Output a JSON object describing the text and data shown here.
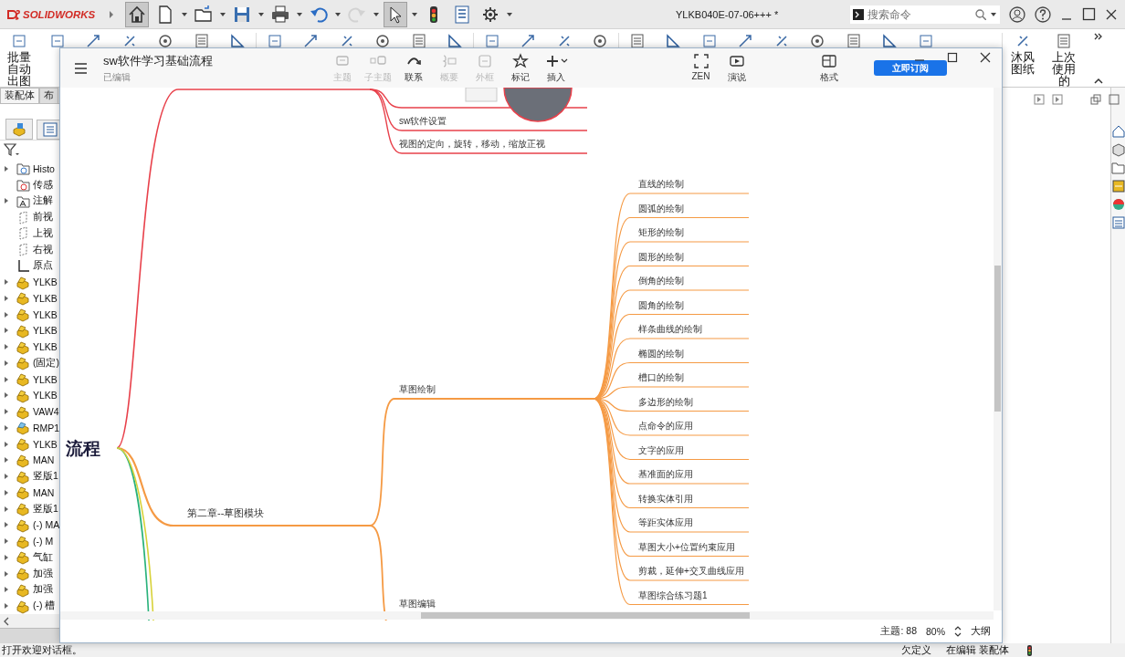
{
  "titlebar": {
    "logo": "SOLIDWORKS",
    "tools": [
      {
        "selected": true,
        "disabled": false
      },
      {
        "selected": false,
        "disabled": false
      },
      {
        "selected": false,
        "disabled": false
      },
      {
        "selected": false,
        "disabled": false
      },
      {
        "selected": false,
        "disabled": false
      },
      {
        "selected": false,
        "disabled": false
      },
      {
        "selected": false,
        "disabled": true
      },
      {
        "selected": true,
        "disabled": false
      },
      {
        "selected": false,
        "disabled": false
      },
      {
        "selected": false,
        "disabled": false
      },
      {
        "selected": false,
        "disabled": false
      }
    ],
    "document_title": "YLKB040E-07-06+++ *",
    "search": {
      "placeholder": "搜索命令"
    }
  },
  "ribbon": {
    "items": [
      {
        "label": "批量自动出图"
      },
      {
        "label": "沐风图纸"
      },
      {
        "label": "上次使用的"
      }
    ]
  },
  "feature_tree": {
    "tabs": [
      {
        "label": "装配体",
        "selected": true
      },
      {
        "label": "布",
        "selected": false
      }
    ],
    "items": [
      {
        "label": "Histo",
        "kind": "history",
        "has_children": true
      },
      {
        "label": "传感",
        "kind": "sensor",
        "has_children": false
      },
      {
        "label": "注解",
        "kind": "annotation",
        "has_children": true
      },
      {
        "label": "前视",
        "kind": "plane",
        "has_children": false
      },
      {
        "label": "上视",
        "kind": "plane",
        "has_children": false
      },
      {
        "label": "右视",
        "kind": "plane",
        "has_children": false
      },
      {
        "label": "原点",
        "kind": "origin",
        "has_children": false
      },
      {
        "label": "YLKB",
        "kind": "part",
        "has_children": true
      },
      {
        "label": "YLKB",
        "kind": "part",
        "has_children": true
      },
      {
        "label": "YLKB",
        "kind": "part",
        "has_children": true
      },
      {
        "label": "YLKB",
        "kind": "part",
        "has_children": true
      },
      {
        "label": "YLKB",
        "kind": "part",
        "has_children": true
      },
      {
        "label": "(固定)",
        "kind": "part",
        "has_children": true
      },
      {
        "label": "YLKB",
        "kind": "part",
        "has_children": true
      },
      {
        "label": "YLKB",
        "kind": "part",
        "has_children": true
      },
      {
        "label": "VAW4",
        "kind": "part",
        "has_children": true
      },
      {
        "label": "RMP1",
        "kind": "component",
        "has_children": true
      },
      {
        "label": "YLKB",
        "kind": "part",
        "has_children": true
      },
      {
        "label": "MAN",
        "kind": "part",
        "has_children": true
      },
      {
        "label": "竖版1",
        "kind": "part",
        "has_children": true
      },
      {
        "label": "MAN",
        "kind": "part",
        "has_children": true
      },
      {
        "label": "竖版1",
        "kind": "part",
        "has_children": true
      },
      {
        "label": "(-) MA",
        "kind": "part",
        "has_children": true
      },
      {
        "label": "(-) M",
        "kind": "part",
        "has_children": true
      },
      {
        "label": "气缸",
        "kind": "part",
        "has_children": true
      },
      {
        "label": "加强",
        "kind": "part",
        "has_children": true
      },
      {
        "label": "加强",
        "kind": "part",
        "has_children": true
      },
      {
        "label": "(-) 槽",
        "kind": "part",
        "has_children": true
      }
    ]
  },
  "status_bar": {
    "message": "打开欢迎对话框。",
    "definition": "欠定义",
    "mode": "在编辑 装配体"
  },
  "mindmap": {
    "title": "sw软件学习基础流程",
    "status": "已编辑",
    "tools": [
      {
        "label": "主题",
        "disabled": true
      },
      {
        "label": "子主题",
        "disabled": true
      },
      {
        "label": "联系",
        "disabled": false
      },
      {
        "label": "概要",
        "disabled": true
      },
      {
        "label": "外框",
        "disabled": true
      },
      {
        "label": "标记",
        "disabled": false
      },
      {
        "label": "插入",
        "disabled": false
      }
    ],
    "view_tools": [
      {
        "label": "ZEN"
      },
      {
        "label": "演说"
      },
      {
        "label": "格式"
      }
    ],
    "subscribe_button": "立即订阅",
    "root": "流程",
    "branches": [
      {
        "color": "#e8414b",
        "children": [
          {
            "kind": "image"
          },
          {
            "kind": "text",
            "label": "sw软件设置"
          },
          {
            "kind": "text",
            "label": "视图的定向，旋转，移动，缩放正视"
          }
        ]
      },
      {
        "color": "#f59a44",
        "label": "第二章--草图模块",
        "children": [
          {
            "kind": "text",
            "label": "草图绘制",
            "children": [
              {
                "label": "直线的绘制"
              },
              {
                "label": "圆弧的绘制"
              },
              {
                "label": "矩形的绘制"
              },
              {
                "label": "圆形的绘制"
              },
              {
                "label": "倒角的绘制"
              },
              {
                "label": "圆角的绘制"
              },
              {
                "label": "样条曲线的绘制"
              },
              {
                "label": "椭圆的绘制"
              },
              {
                "label": "槽口的绘制"
              },
              {
                "label": "多边形的绘制"
              },
              {
                "label": "点命令的应用"
              },
              {
                "label": "文字的应用"
              },
              {
                "label": "基准面的应用"
              },
              {
                "label": "转换实体引用"
              },
              {
                "label": "等距实体应用"
              },
              {
                "label": "草图大小+位置约束应用"
              },
              {
                "label": "剪裁，延伸+交叉曲线应用"
              },
              {
                "label": "草图综合练习题1"
              }
            ]
          },
          {
            "kind": "text",
            "label": "草图编辑"
          }
        ]
      },
      {
        "color": "#2ab27b"
      },
      {
        "color": "#d8d23a"
      }
    ],
    "topic_count": "主题: 88",
    "zoom": "80%",
    "outline_button": "大纲"
  }
}
